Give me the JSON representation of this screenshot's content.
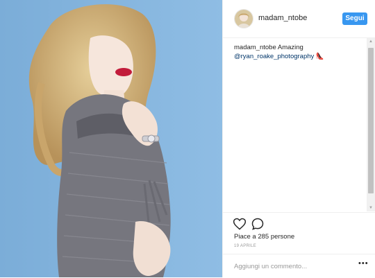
{
  "post": {
    "username": "madam_ntobe",
    "follow_label": "Segui",
    "caption_user": "madam_ntobe",
    "caption_text": "Amazing",
    "caption_mention": "@ryan_roake_photography",
    "caption_emoji": "👠",
    "likes_text": "Piace a 285 persone",
    "date": "19 APRILE",
    "comment_placeholder": "Aggiungi un commento...",
    "more_label": "•••"
  },
  "icons": [
    "heart-icon",
    "comment-icon",
    "more-options-icon"
  ],
  "colors": {
    "accent": "#3897f0",
    "background_wall": "#86b6df",
    "text": "#262626",
    "muted": "#999999"
  }
}
